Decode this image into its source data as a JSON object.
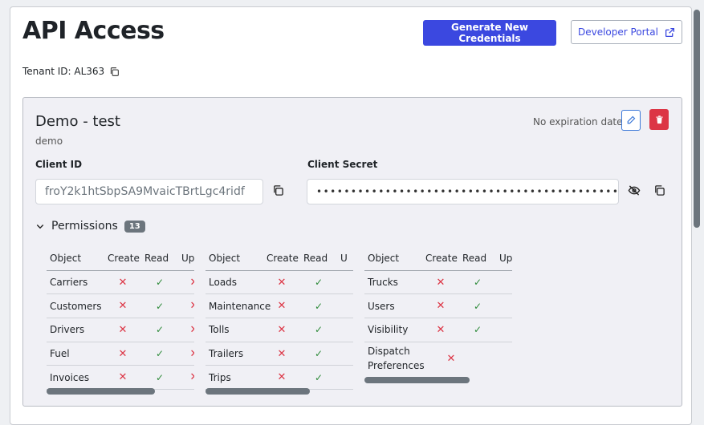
{
  "page": {
    "title": "API Access",
    "generate_label": "Generate New Credentials",
    "portal_label": "Developer Portal",
    "tenant_label": "Tenant ID: AL363"
  },
  "credential": {
    "name": "Demo - test",
    "description": "demo",
    "expiry": "No expiration date",
    "client_id_label": "Client ID",
    "client_id_value": "froY2k1htSbpSA9MvaicTBrtLgc4ridf",
    "client_secret_label": "Client Secret",
    "client_secret_value": "••••••••••••••••••••••••••••••••••••••••••••••••",
    "permissions_label": "Permissions",
    "permissions_count": "13"
  },
  "tables": [
    {
      "headers": [
        "Object",
        "Create",
        "Read",
        "Upd"
      ],
      "rows": [
        {
          "object": "Carriers",
          "create": "✕",
          "read": "✓",
          "update": "✕"
        },
        {
          "object": "Customers",
          "create": "✕",
          "read": "✓",
          "update": "✕"
        },
        {
          "object": "Drivers",
          "create": "✕",
          "read": "✓",
          "update": "✕"
        },
        {
          "object": "Fuel",
          "create": "✕",
          "read": "✓",
          "update": "✕"
        },
        {
          "object": "Invoices",
          "create": "✕",
          "read": "✓",
          "update": "✕"
        }
      ]
    },
    {
      "headers": [
        "Object",
        "Create",
        "Read",
        "U"
      ],
      "rows": [
        {
          "object": "Loads",
          "create": "✕",
          "read": "✓",
          "update": ""
        },
        {
          "object": "Maintenance",
          "create": "✕",
          "read": "✓",
          "update": ""
        },
        {
          "object": "Tolls",
          "create": "✕",
          "read": "✓",
          "update": ""
        },
        {
          "object": "Trailers",
          "create": "✕",
          "read": "✓",
          "update": ""
        },
        {
          "object": "Trips",
          "create": "✕",
          "read": "✓",
          "update": ""
        }
      ]
    },
    {
      "headers": [
        "Object",
        "Create",
        "Read",
        "Up"
      ],
      "rows": [
        {
          "object": "Trucks",
          "create": "✕",
          "read": "✓",
          "update": ""
        },
        {
          "object": "Users",
          "create": "✕",
          "read": "✓",
          "update": ""
        },
        {
          "object": "Visibility",
          "create": "✕",
          "read": "✓",
          "update": ""
        },
        {
          "object": "Dispatch\nPreferences",
          "create": "✕",
          "read": "",
          "update": ""
        }
      ]
    }
  ],
  "icons": {
    "copy": "copy-icon",
    "external": "external-link-icon",
    "edit": "pencil-icon",
    "delete": "trash-icon",
    "visibility": "eye-off-icon",
    "chevron": "chevron-down-icon"
  }
}
